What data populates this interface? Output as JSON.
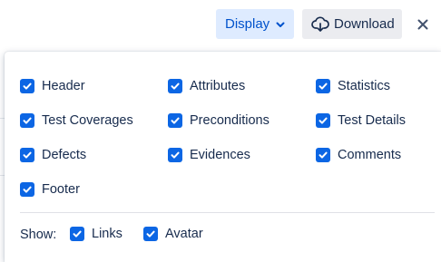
{
  "toolbar": {
    "display_label": "Display",
    "download_label": "Download"
  },
  "panel": {
    "options": [
      {
        "label": "Header",
        "checked": true
      },
      {
        "label": "Attributes",
        "checked": true
      },
      {
        "label": "Statistics",
        "checked": true
      },
      {
        "label": "Test Coverages",
        "checked": true
      },
      {
        "label": "Preconditions",
        "checked": true
      },
      {
        "label": "Test Details",
        "checked": true
      },
      {
        "label": "Defects",
        "checked": true
      },
      {
        "label": "Evidences",
        "checked": true
      },
      {
        "label": "Comments",
        "checked": true
      },
      {
        "label": "Footer",
        "checked": true
      }
    ],
    "show_label": "Show:",
    "show_options": [
      {
        "label": "Links",
        "checked": true
      },
      {
        "label": "Avatar",
        "checked": true
      }
    ]
  },
  "colors": {
    "checkbox": "#0c66e4",
    "display_bg": "#deebff",
    "display_text": "#0052cc",
    "download_bg": "#ebecf0"
  },
  "icons": {
    "display": "chevron-down-icon",
    "download": "cloud-download-icon",
    "close": "close-icon"
  }
}
